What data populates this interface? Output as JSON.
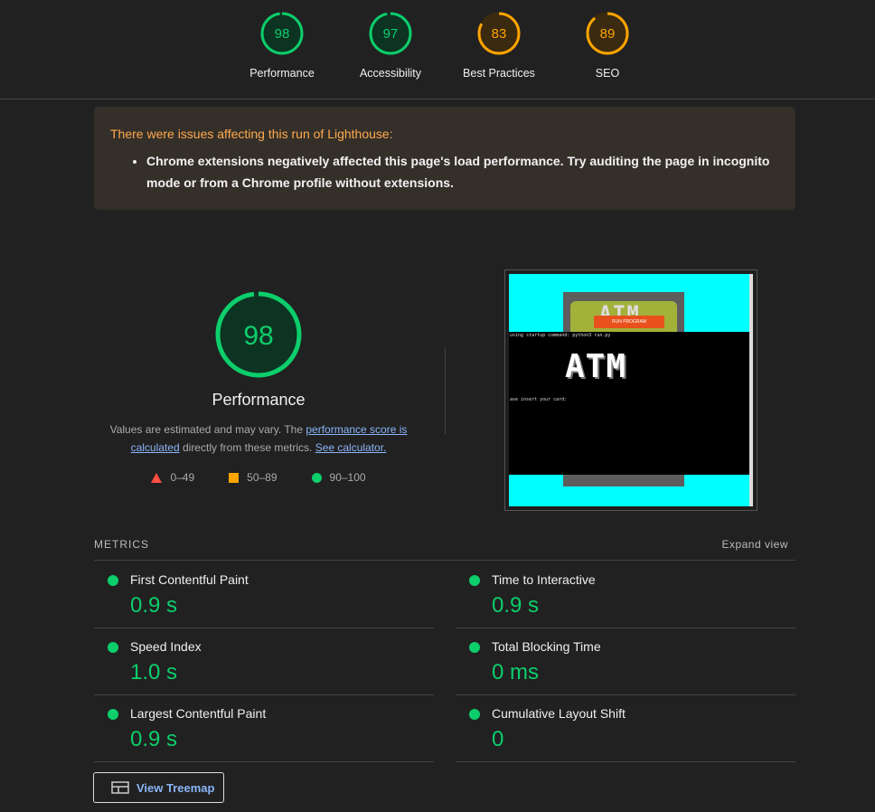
{
  "gauges": [
    {
      "score": "98",
      "label": "Performance",
      "color": "#0cce6b",
      "fill": "#0d3322"
    },
    {
      "score": "97",
      "label": "Accessibility",
      "color": "#0cce6b",
      "fill": "#0d3322"
    },
    {
      "score": "83",
      "label": "Best Practices",
      "color": "#ffa400",
      "fill": "#3a2a10"
    },
    {
      "score": "89",
      "label": "SEO",
      "color": "#ffa400",
      "fill": "#3a2a10"
    }
  ],
  "warning": {
    "title": "There were issues affecting this run of Lighthouse:",
    "item": "Chrome extensions negatively affected this page's load performance. Try auditing the page in incognito mode or from a Chrome profile without extensions."
  },
  "performance": {
    "score": "98",
    "title": "Performance",
    "desc_prefix": "Values are estimated and may vary. The ",
    "link1": "performance score is calculated",
    "desc_mid": " directly from these metrics. ",
    "link2": "See calculator."
  },
  "legend": {
    "fail": "0–49",
    "average": "50–89",
    "pass": "90–100"
  },
  "screenshot": {
    "atm_top": "ATM",
    "run_button": "RUN PROGRAM",
    "term_line1": "using startup command: python3 run.py",
    "atm_big": "ATM",
    "term_line2": "ase insert your card:"
  },
  "metrics": {
    "heading": "METRICS",
    "expand": "Expand view",
    "items": [
      {
        "name": "First Contentful Paint",
        "value": "0.9 s"
      },
      {
        "name": "Time to Interactive",
        "value": "0.9 s"
      },
      {
        "name": "Speed Index",
        "value": "1.0 s"
      },
      {
        "name": "Total Blocking Time",
        "value": "0 ms"
      },
      {
        "name": "Largest Contentful Paint",
        "value": "0.9 s"
      },
      {
        "name": "Cumulative Layout Shift",
        "value": "0"
      }
    ]
  },
  "treemap": {
    "label": "View Treemap"
  },
  "colors": {
    "pass": "#0cce6b",
    "average": "#ffa400",
    "fail": "#ff4e42",
    "link": "#8ab4f8"
  }
}
